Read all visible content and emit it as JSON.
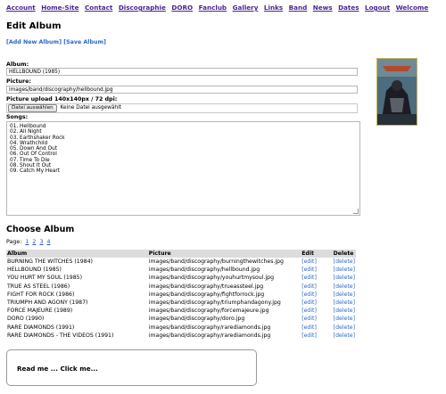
{
  "nav": [
    "Account",
    "Home-Site",
    "Contact",
    "Discographie",
    "DORO",
    "Fanclub",
    "Gallery",
    "Links",
    "Band",
    "News",
    "Dates",
    "Logout",
    "Welcome"
  ],
  "edit": {
    "title": "Edit Album",
    "add_label": "[Add New Album]",
    "save_label": "[Save Album]",
    "album_label": "Album:",
    "album_value": "HELLBOUND (1985)",
    "picture_label": "Picture:",
    "picture_value": "images/band/discography/hellbound.jpg",
    "upload_label": "Picture upload 140x140px / 72 dpi:",
    "file_button": "Datei auswählen",
    "file_status": "Keine Datei ausgewählt",
    "songs_label": "Songs:",
    "songs": [
      "01. Hellbound",
      "02. All Night",
      "03. Earthshaker Rock",
      "04. Wrathchild",
      "05. Down And Out",
      "06. Out Of Control",
      "07. Time To Die",
      "08. Shout It Out",
      "09. Catch My Heart"
    ]
  },
  "choose": {
    "title": "Choose Album",
    "page_label": "Page:",
    "pages": [
      "1",
      "2",
      "3",
      "4"
    ],
    "columns": [
      "Album",
      "Picture",
      "Edit",
      "Delete"
    ],
    "rows": [
      {
        "album": "BURNING THE WITCHES (1984)",
        "picture": "images/band/discography/burningthewitches.jpg",
        "edit": "[edit]",
        "delete": "[delete]"
      },
      {
        "album": "HELLBOUND (1985)",
        "picture": "images/band/discography/hellbound.jpg",
        "edit": "[edit]",
        "delete": "[delete]"
      },
      {
        "album": "YOU HURT MY SOUL (1985)",
        "picture": "images/band/discography/youhurtmysoul.jpg",
        "edit": "[edit]",
        "delete": "[delete]"
      },
      {
        "album": "TRUE AS STEEL (1986)",
        "picture": "images/band/discography/trueassteel.jpg",
        "edit": "[edit]",
        "delete": "[delete]"
      },
      {
        "album": "FIGHT FOR ROCK (1986)",
        "picture": "images/band/discography/fightforrock.jpg",
        "edit": "[edit]",
        "delete": "[delete]"
      },
      {
        "album": "TRIUMPH AND AGONY (1987)",
        "picture": "images/band/discography/triumphandagony.jpg",
        "edit": "[edit]",
        "delete": "[delete]"
      },
      {
        "album": "FORCE MAJEURE (1989)",
        "picture": "images/band/discography/forcemajeure.jpg",
        "edit": "[edit]",
        "delete": "[delete]"
      },
      {
        "album": "DORO (1990)",
        "picture": "images/band/discography/doro.jpg",
        "edit": "[edit]",
        "delete": "[delete]"
      },
      {
        "album": "RARE DIAMONDS (1991)",
        "picture": "images/band/discography/rarediamonds.jpg",
        "edit": "[edit]",
        "delete": "[delete]"
      },
      {
        "album": "RARE DIAMONDS - THE VIDEOS (1991)",
        "picture": "images/band/discography/rarediamonds.jpg",
        "edit": "[edit]",
        "delete": "[delete]"
      }
    ]
  },
  "readme": "Read me ... Click me...",
  "colors": {
    "nav_link": "#4a2590",
    "action_link": "#2a67c8",
    "header_bg": "#dcdcdc"
  }
}
